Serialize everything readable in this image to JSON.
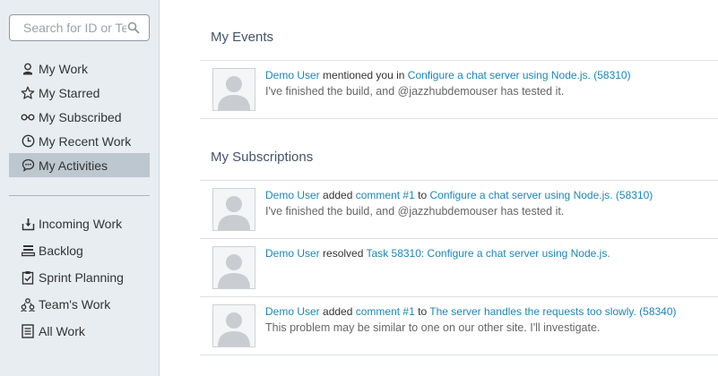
{
  "search": {
    "placeholder": "Search for ID or Text"
  },
  "nav_primary": [
    {
      "label": "My Work",
      "icon": "person-icon"
    },
    {
      "label": "My Starred",
      "icon": "star-icon"
    },
    {
      "label": "My Subscribed",
      "icon": "glasses-icon"
    },
    {
      "label": "My Recent Work",
      "icon": "clock-icon"
    },
    {
      "label": "My Activities",
      "icon": "chat-bubble-icon",
      "active": true
    }
  ],
  "nav_secondary": [
    {
      "label": "Incoming Work",
      "icon": "inbox-download-icon"
    },
    {
      "label": "Backlog",
      "icon": "stack-icon"
    },
    {
      "label": "Sprint Planning",
      "icon": "clipboard-check-icon"
    },
    {
      "label": "Team's Work",
      "icon": "team-icon"
    },
    {
      "label": "All Work",
      "icon": "list-icon"
    }
  ],
  "events": {
    "title": "My Events",
    "items": [
      {
        "user": "Demo User",
        "verb": "mentioned you in",
        "target": "Configure a chat server using Node.js. (58310)",
        "message": "I've finished the build, and @jazzhubdemouser has tested it."
      }
    ]
  },
  "subscriptions": {
    "title": "My Subscriptions",
    "items": [
      {
        "user": "Demo User",
        "verb": "added",
        "comment": "comment #1",
        "connector": "to",
        "target": "Configure a chat server using Node.js. (58310)",
        "message": "I've finished the build, and @jazzhubdemouser has tested it."
      },
      {
        "user": "Demo User",
        "verb": "resolved",
        "target": "Task 58310: Configure a chat server using Node.js.",
        "message": ""
      },
      {
        "user": "Demo User",
        "verb": "added",
        "comment": "comment #1",
        "connector": "to",
        "target": "The server handles the requests too slowly. (58340)",
        "message": "This problem may be similar to one on our other site. I'll investigate."
      }
    ]
  },
  "colors": {
    "sidebar_bg": "#e8edf1",
    "active_bg": "#bcc7cf",
    "link": "#1c86b4",
    "title": "#44546a"
  }
}
